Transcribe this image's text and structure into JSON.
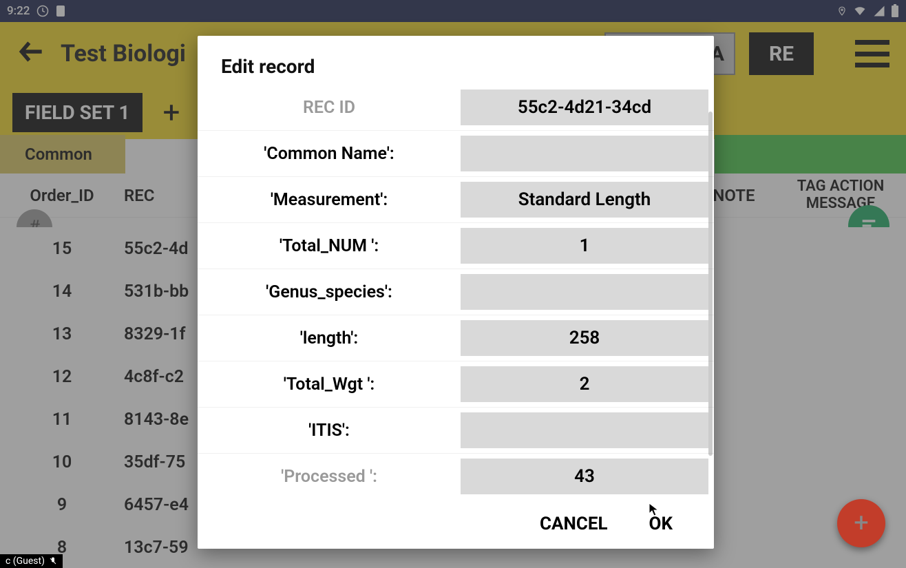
{
  "status": {
    "time": "9:22"
  },
  "app": {
    "title": "Test Biologi",
    "btn_a": "A",
    "btn_re": "RE"
  },
  "fieldset": {
    "label": "FIELD SET 1"
  },
  "badges": {
    "common": "Common",
    "right": ""
  },
  "table": {
    "headers": {
      "order": "Order_ID",
      "rec": "REC",
      "note": "NOTE",
      "tag": "TAG ACTION MESSAGE"
    },
    "rows": [
      {
        "order": "15",
        "rec": "55c2-4d"
      },
      {
        "order": "14",
        "rec": "531b-bb"
      },
      {
        "order": "13",
        "rec": "8329-1f"
      },
      {
        "order": "12",
        "rec": "4c8f-c2"
      },
      {
        "order": "11",
        "rec": "8143-8e"
      },
      {
        "order": "10",
        "rec": "35df-75"
      },
      {
        "order": "9",
        "rec": "6457-e4"
      },
      {
        "order": "8",
        "rec": "13c7-59"
      }
    ]
  },
  "dialog": {
    "title": "Edit record",
    "fields": [
      {
        "label": "REC ID",
        "value": "55c2-4d21-34cd",
        "muted": true
      },
      {
        "label": "'Common Name':",
        "value": ""
      },
      {
        "label": "'Measurement':",
        "value": "Standard Length"
      },
      {
        "label": "'Total_NUM ':",
        "value": "1"
      },
      {
        "label": "'Genus_species':",
        "value": ""
      },
      {
        "label": "'length':",
        "value": "258"
      },
      {
        "label": "'Total_Wgt ':",
        "value": "2"
      },
      {
        "label": "'ITIS':",
        "value": ""
      },
      {
        "label": "'Processed ':",
        "value": "43",
        "muted": true
      }
    ],
    "cancel": "CANCEL",
    "ok": "OK"
  },
  "guest": "c (Guest)"
}
